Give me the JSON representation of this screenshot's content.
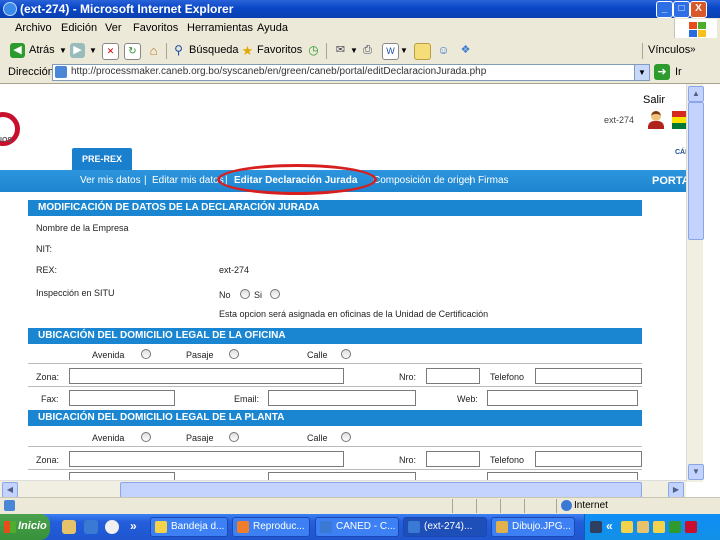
{
  "window": {
    "title": "(ext-274) - Microsoft Internet Explorer",
    "controls": [
      "_",
      "□",
      "X"
    ]
  },
  "menu": {
    "items": [
      "Archivo",
      "Edición",
      "Ver",
      "Favoritos",
      "Herramientas",
      "Ayuda"
    ]
  },
  "toolbar": {
    "back_label": "Atrás",
    "search_label": "Búsqueda",
    "favorites_label": "Favoritos",
    "links_label": "Vínculos"
  },
  "address": {
    "label": "Dirección",
    "url": "http://processmaker.caneb.org.bo/syscaneb/en/green/caneb/portal/editDeclaracionJurada.php"
  },
  "header": {
    "logo_text": "IOS",
    "salir": "Salir",
    "user": "ext-274",
    "camara_text": "CÁMA",
    "tab_label": "PRE-REX"
  },
  "nav": {
    "items": [
      "Ver mis datos",
      "Editar mis datos",
      "Editar Declaración Jurada",
      "Composición de origen",
      "Firmas"
    ],
    "portal": "PORTA"
  },
  "form": {
    "section1_title": "MODIFICACIÓN DE DATOS DE LA DECLARACIÓN JURADA",
    "empresa_label": "Nombre de la Empresa",
    "nit_label": "NIT:",
    "rex_label": "REX:",
    "rex_value": "ext-274",
    "inspeccion_label": "Inspección en SITU",
    "no_label": "No",
    "si_label": "Si",
    "note": "Esta opcion será asignada en oficinas de la Unidad de Certificación",
    "section2_title": "UBICACIÓN DEL DOMICILIO LEGAL DE LA OFICINA",
    "section3_title": "UBICACIÓN DEL DOMICILIO LEGAL DE LA PLANTA",
    "avenida": "Avenida",
    "pasaje": "Pasaje",
    "calle": "Calle",
    "zona": "Zona:",
    "nro": "Nro:",
    "telefono": "Telefono",
    "fax": "Fax:",
    "email": "Email:",
    "web": "Web:"
  },
  "status": {
    "zone": "Internet"
  },
  "taskbar": {
    "start": "Inicio",
    "tasks": [
      "Bandeja d...",
      "Reproduc...",
      "CANED - C...",
      "(ext-274)...",
      "Dibujo.JPG..."
    ],
    "chevron": "»"
  },
  "colors": {
    "accent_blue": "#1a86d2",
    "highlight_red": "#d81f1f",
    "xp_blue": "#245edb"
  }
}
